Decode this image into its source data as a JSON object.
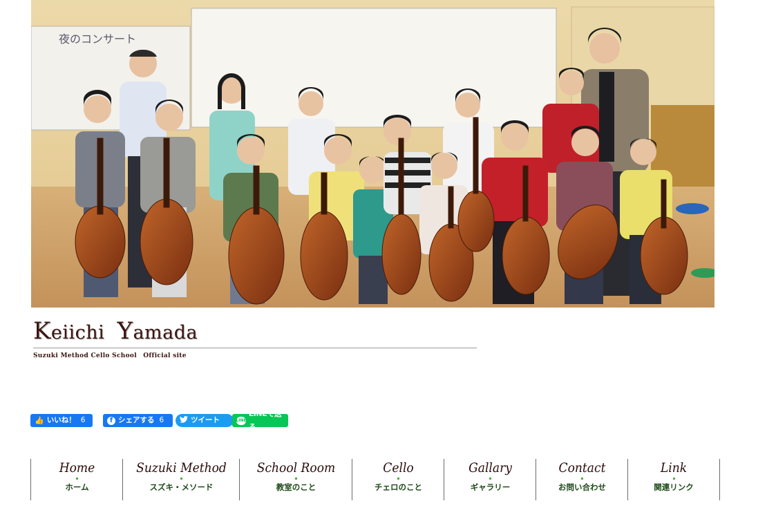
{
  "hero": {
    "alt_icon": "group-photo",
    "board_text": "夜のコンサート"
  },
  "logo": {
    "initial_1": "K",
    "rest_1": "eiichi",
    "initial_2": "Y",
    "rest_2": "amada",
    "subtitle": "Suzuki Method Cello School　Official site"
  },
  "social": {
    "fb_like_label": "いいね！",
    "fb_like_count": "6",
    "fb_share_label": "シェアする",
    "fb_share_count": "6",
    "tweet_label": "ツイート",
    "line_label": "LINEで送る",
    "colors": {
      "facebook": "#1877f2",
      "twitter": "#1d9bf0",
      "line": "#06c755"
    }
  },
  "nav": {
    "items": [
      {
        "en": "Home",
        "ja": "ホーム"
      },
      {
        "en": "Suzuki Method",
        "ja": "スズキ・メソード"
      },
      {
        "en": "School Room",
        "ja": "教室のこと"
      },
      {
        "en": "Cello",
        "ja": "チェロのこと"
      },
      {
        "en": "Gallary",
        "ja": "ギャラリー"
      },
      {
        "en": "Contact",
        "ja": "お問い合わせ"
      },
      {
        "en": "Link",
        "ja": "関連リンク"
      }
    ]
  }
}
